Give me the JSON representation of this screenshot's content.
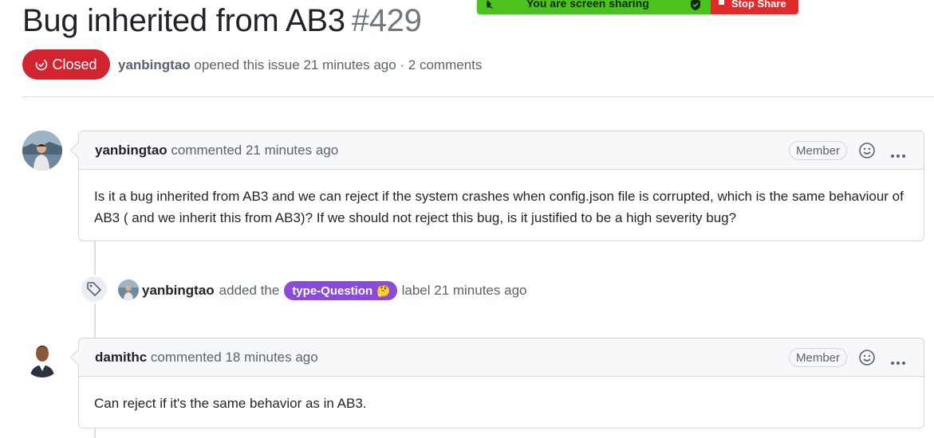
{
  "share_banner": {
    "sharing_text": "You are screen sharing",
    "stop_label": "Stop Share"
  },
  "issue": {
    "title": "Bug inherited from AB3",
    "number": "#429",
    "state": "Closed",
    "author": "yanbingtao",
    "opened_text": "opened this issue 21 minutes ago · 2 comments"
  },
  "comments": [
    {
      "author": "yanbingtao",
      "meta": "commented 21 minutes ago",
      "role": "Member",
      "body": "Is it a bug inherited from AB3 and we can reject if the system crashes when config.json file is corrupted, which is the same behaviour of AB3 ( and we inherit this from AB3)? If we should not reject this bug, is it justified to be a high severity bug?"
    },
    {
      "author": "damithc",
      "meta": "commented 18 minutes ago",
      "role": "Member",
      "body": "Can reject if it's the same behavior as in AB3."
    }
  ],
  "label_event": {
    "actor": "yanbingtao",
    "action": "added the",
    "label": "type-Question",
    "label_emoji": "🤔",
    "suffix": "label 21 minutes ago"
  },
  "colors": {
    "closed_red": "#d1242f",
    "label_purple": "#8a4bd8",
    "share_green": "#4cc21f",
    "share_red": "#e02b2b"
  }
}
